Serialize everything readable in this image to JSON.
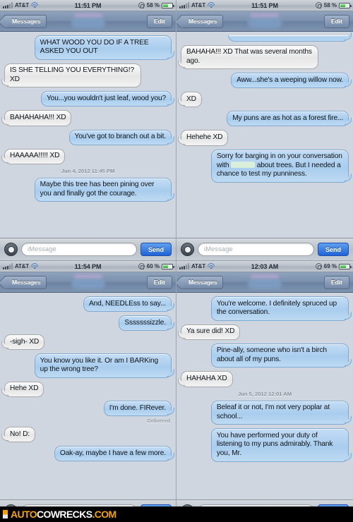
{
  "meta": {
    "watermark": {
      "part1": "AUTO",
      "part2": "COWRECKS",
      "part3": ".COM"
    }
  },
  "common": {
    "carrier": "AT&T",
    "back_label": "Messages",
    "edit_label": "Edit",
    "input_placeholder": "iMessage",
    "send_label": "Send",
    "delivered_label": "Delivered"
  },
  "panels": [
    {
      "id": "panel-1",
      "status": {
        "time": "11:51 PM",
        "battery": "58 %",
        "battery_pct": 58
      },
      "messages": [
        {
          "side": "out",
          "text": "WHAT WOOD YOU DO IF A TREE ASKED YOU OUT"
        },
        {
          "side": "in",
          "text": "IS SHE TELLING YOU EVERYTHING!? XD"
        },
        {
          "side": "out",
          "text": "You...you wouldn't just leaf, wood you?"
        },
        {
          "side": "in",
          "text": "BAHAHAHA!!! XD"
        },
        {
          "side": "out",
          "text": "You've got to branch out a bit."
        },
        {
          "side": "in",
          "text": "HAAAAA!!!!! XD"
        },
        {
          "side": "timestamp",
          "text": "Jun 4, 2012 11:45 PM"
        },
        {
          "side": "out",
          "text": "Maybe this tree has been pining over you and finally got the courage."
        }
      ]
    },
    {
      "id": "panel-2",
      "status": {
        "time": "11:51 PM",
        "battery": "58 %",
        "battery_pct": 58
      },
      "messages": [
        {
          "side": "out",
          "text": "",
          "cut_top": true
        },
        {
          "side": "in",
          "text": "BAHAHA!!! XD That was several months ago."
        },
        {
          "side": "out",
          "text": "Aww...she's a weeping willow now."
        },
        {
          "side": "in",
          "text": "XD"
        },
        {
          "side": "out",
          "text": "My puns are as hot as a forest fire..."
        },
        {
          "side": "in",
          "text": "Hehehe XD"
        },
        {
          "side": "out",
          "text_before": "Sorry for barging in on your conversation with ",
          "redacted": true,
          "text_after": " about trees. But I needed a chance to test my punniness."
        }
      ]
    },
    {
      "id": "panel-3",
      "status": {
        "time": "11:54 PM",
        "battery": "60 %",
        "battery_pct": 60
      },
      "messages": [
        {
          "side": "out",
          "text": "And, NEEDLEss to say..."
        },
        {
          "side": "out",
          "text": "Sssssssizzle."
        },
        {
          "side": "in",
          "text": "-sigh- XD"
        },
        {
          "side": "out",
          "text": "You know you like it. Or am I BARKing up the wrong tree?"
        },
        {
          "side": "in",
          "text": "Hehe XD"
        },
        {
          "side": "out",
          "text": "I'm done. FIRever."
        },
        {
          "side": "delivered",
          "text": "Delivered"
        },
        {
          "side": "in",
          "text": "No! D:"
        },
        {
          "side": "out",
          "text": "Oak-ay, maybe I have a few more."
        }
      ]
    },
    {
      "id": "panel-4",
      "status": {
        "time": "12:03 AM",
        "battery": "69 %",
        "battery_pct": 69
      },
      "messages": [
        {
          "side": "out",
          "text": "You're welcome. I definitely spruced up the conversation."
        },
        {
          "side": "in",
          "text": "Ya sure did! XD"
        },
        {
          "side": "out",
          "text": "Pine-ally, someone who isn't a birch about all of my puns."
        },
        {
          "side": "in",
          "text": "HAHAHA XD"
        },
        {
          "side": "timestamp",
          "text": "Jun 5, 2012 12:01 AM"
        },
        {
          "side": "out",
          "text": "Beleaf it or not, I'm not very poplar at school..."
        },
        {
          "side": "out",
          "text": "You have performed your duty of listening to my puns admirably. Thank you, Mr."
        }
      ]
    }
  ]
}
